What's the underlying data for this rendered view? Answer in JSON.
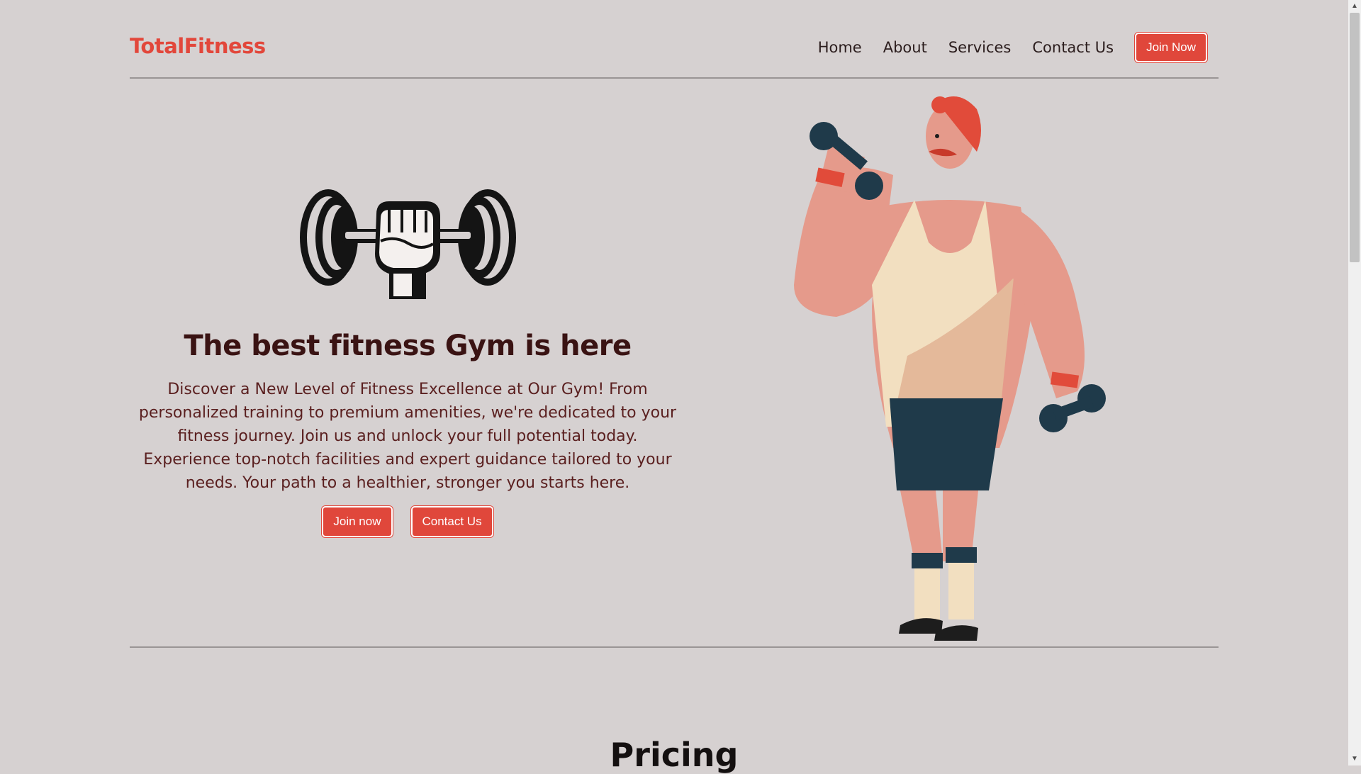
{
  "header": {
    "logo": "TotalFitness",
    "nav": [
      "Home",
      "About",
      "Services",
      "Contact Us"
    ],
    "cta": "Join Now"
  },
  "hero": {
    "title": "The best fitness Gym is here",
    "text": "Discover a New Level of Fitness Excellence at Our Gym! From personalized training to premium amenities, we're dedicated to your fitness journey. Join us and unlock your full potential today. Experience top-notch facilities and expert guidance tailored to your needs. Your path to a healthier, stronger you starts here.",
    "primary_button": "Join now",
    "secondary_button": "Contact Us",
    "logo_icon": "dumbbell-fist-icon",
    "illustration": "muscleman-illustration"
  },
  "pricing": {
    "title": "Pricing"
  },
  "colors": {
    "accent": "#e0473b",
    "background": "#d6d1d1",
    "heading": "#3a1313"
  }
}
